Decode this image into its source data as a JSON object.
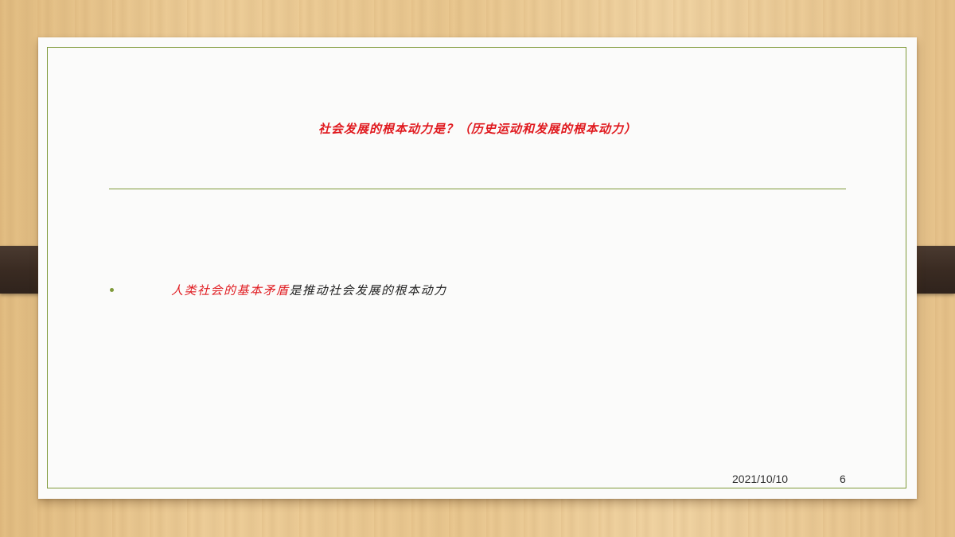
{
  "slide": {
    "title": "社会发展的根本动力是？（历史运动和发展的根本动力）",
    "bullet": {
      "highlight": "人类社会的基本矛盾",
      "rest": "是推动社会发展的根本动力"
    },
    "footer": {
      "date": "2021/10/10",
      "page_number": "6"
    }
  },
  "colors": {
    "accent_green": "#7f9a3a",
    "title_red": "#e0191e",
    "body_text": "#222222"
  }
}
